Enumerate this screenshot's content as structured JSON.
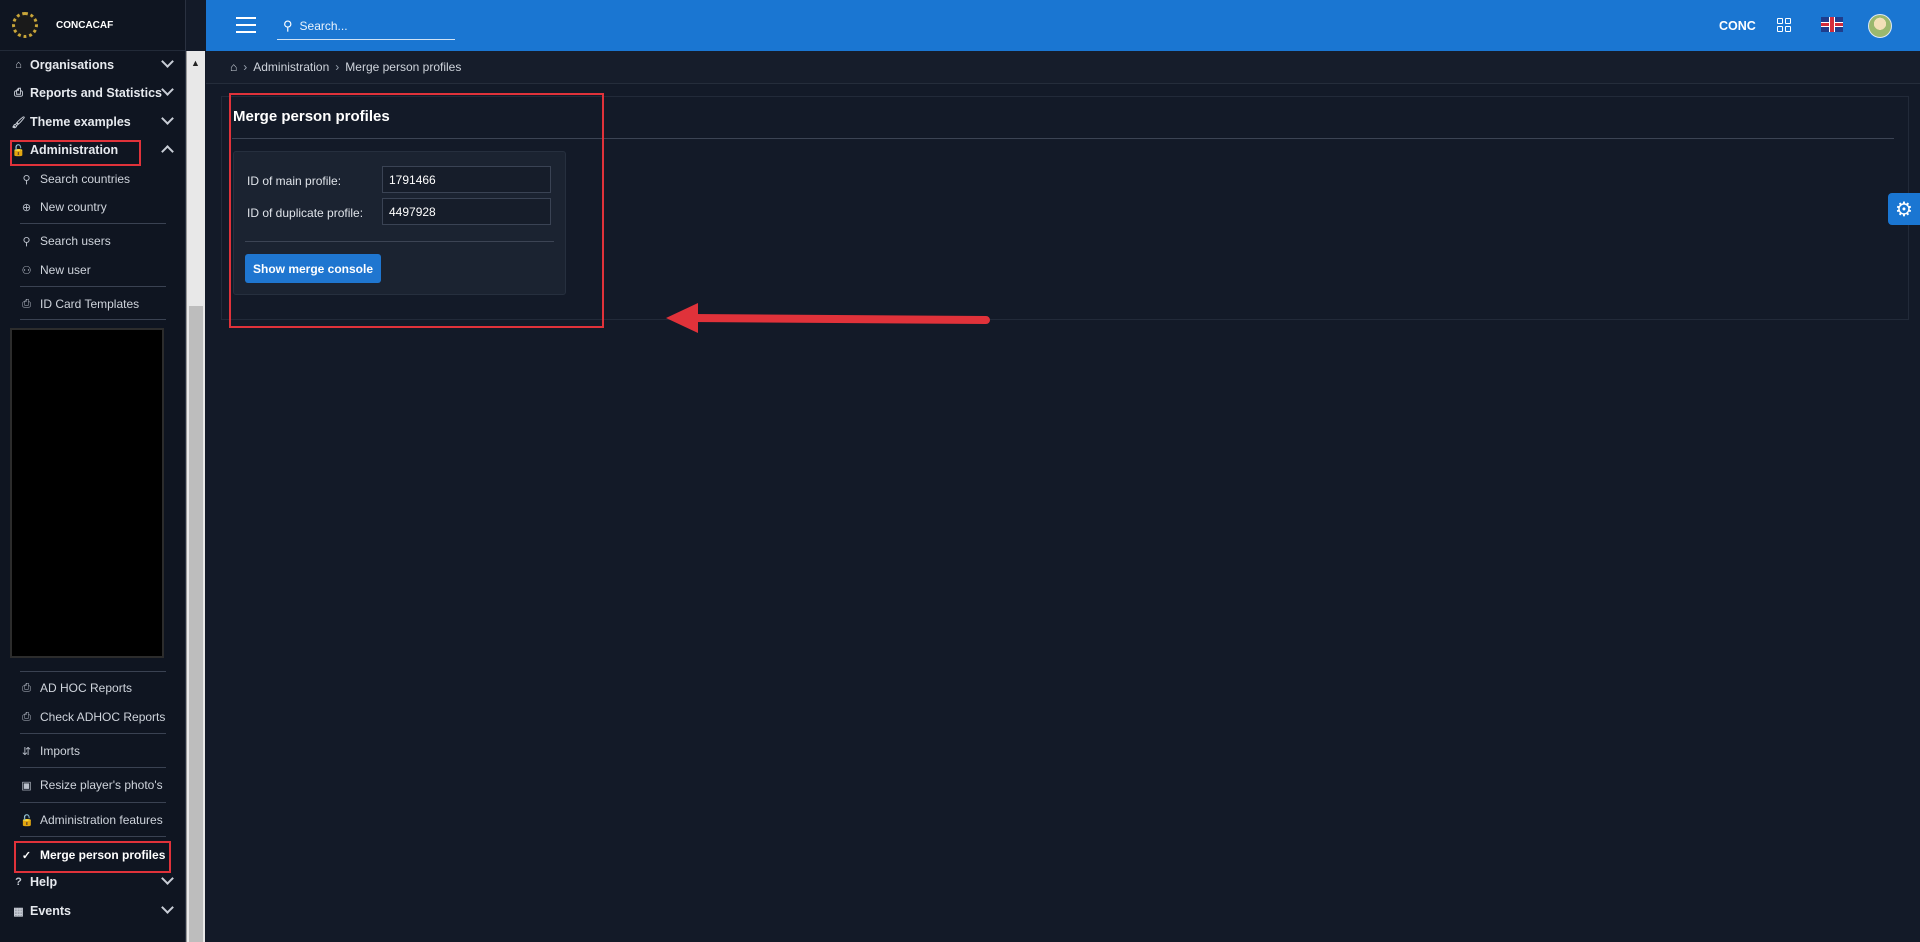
{
  "brand": {
    "name": "CONCACAF"
  },
  "topbar": {
    "search_placeholder": "Search...",
    "user_code": "CONC"
  },
  "sidebar": {
    "sections": [
      {
        "label": "Organisations",
        "icon": "building-icon"
      },
      {
        "label": "Reports and Statistics",
        "icon": "printer-icon"
      },
      {
        "label": "Theme examples",
        "icon": "paint-roller-icon"
      },
      {
        "label": "Administration",
        "icon": "lock-icon"
      },
      {
        "label": "Help",
        "icon": "help-circle-icon"
      },
      {
        "label": "Events",
        "icon": "calendar-icon"
      }
    ],
    "admin_items": [
      {
        "label": "Search countries",
        "icon": "search-icon"
      },
      {
        "label": "New country",
        "icon": "globe-icon"
      },
      {
        "label": "Search users",
        "icon": "search-icon"
      },
      {
        "label": "New user",
        "icon": "user-plus-icon"
      },
      {
        "label": "ID Card Templates",
        "icon": "printer-icon"
      },
      {
        "label": "AD HOC Reports",
        "icon": "printer-icon"
      },
      {
        "label": "Check ADHOC Reports",
        "icon": "printer-icon"
      },
      {
        "label": "Imports",
        "icon": "import-icon"
      },
      {
        "label": "Resize player's photo's",
        "icon": "image-icon"
      },
      {
        "label": "Administration features",
        "icon": "lock-icon"
      },
      {
        "label": "Merge person profiles",
        "icon": "check-icon"
      }
    ]
  },
  "breadcrumb": {
    "items": [
      "Administration",
      "Merge person profiles"
    ]
  },
  "main": {
    "title": "Merge person profiles",
    "main_profile_label": "ID of main profile:",
    "main_profile_value": "1791466",
    "duplicate_profile_label": "ID of duplicate profile:",
    "duplicate_profile_value": "4497928",
    "merge_button": "Show merge console"
  },
  "colors": {
    "topbar": "#1a76d2",
    "background": "#131a28",
    "highlight": "#e0323a"
  }
}
